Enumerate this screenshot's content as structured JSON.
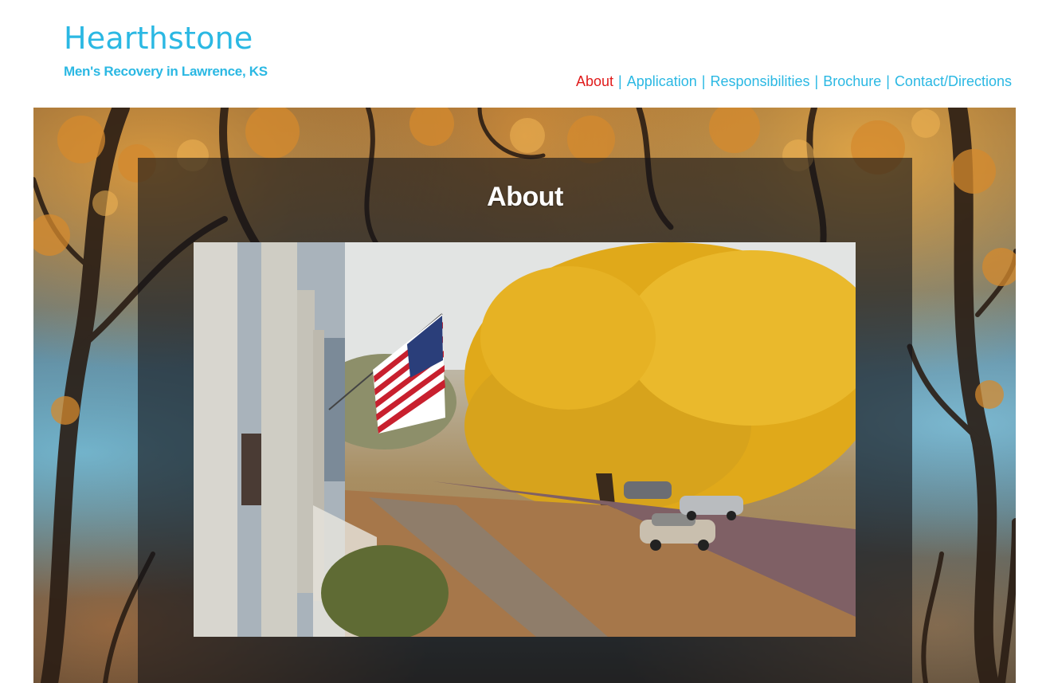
{
  "site": {
    "title": "Hearthstone",
    "tagline": "Men's Recovery in Lawrence, KS"
  },
  "nav": {
    "items": [
      {
        "label": "About",
        "active": true
      },
      {
        "label": "Application",
        "active": false
      },
      {
        "label": "Responsibilities",
        "active": false
      },
      {
        "label": "Brochure",
        "active": false
      },
      {
        "label": "Contact/Directions",
        "active": false
      }
    ],
    "separator": "|"
  },
  "main": {
    "heading": "About",
    "photo_icon": "porch-flag-autumn-street-photo",
    "background_icon": "autumn-trees-background-photo"
  },
  "colors": {
    "brand": "#2bb8e3",
    "active_nav": "#e01b1b",
    "panel": "#141418"
  }
}
